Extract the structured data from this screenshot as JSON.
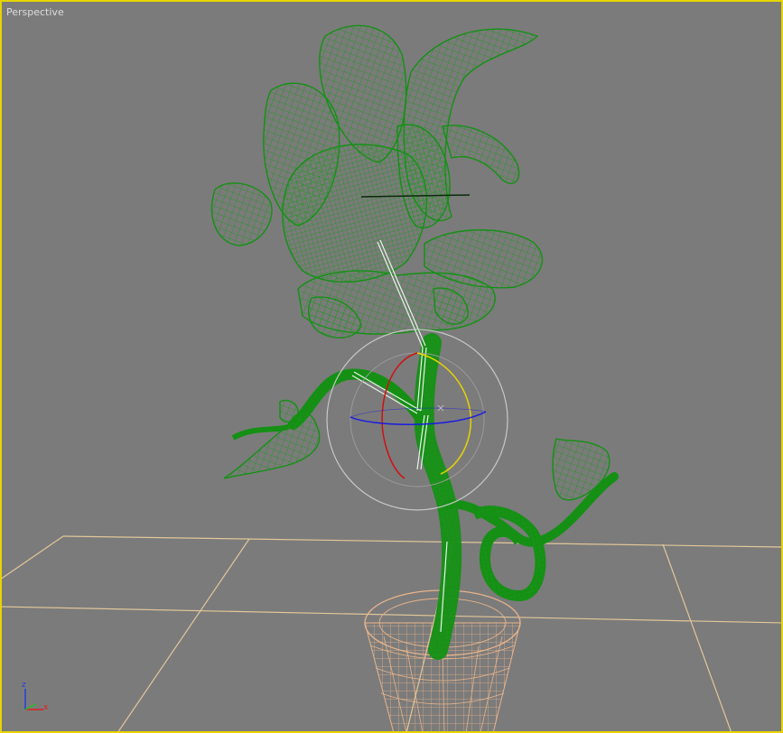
{
  "viewport": {
    "label": "Perspective",
    "border_color": "#e6d400",
    "background": "#7b7b7b"
  },
  "scene": {
    "objects": [
      {
        "name": "flower",
        "type": "wireframe mesh",
        "color": "#1a8c1a"
      },
      {
        "name": "pot",
        "type": "wireframe mesh",
        "color": "#e8b48a"
      },
      {
        "name": "ground-grid",
        "type": "grid",
        "color": "#e2c79a"
      }
    ],
    "gizmo": {
      "type": "rotate",
      "colors": {
        "x": "#d01010",
        "y": "#e6d400",
        "z": "#1a1ae0",
        "outer": "#c8c8c8"
      }
    }
  },
  "axis_tripod": {
    "z_label": "z",
    "x_label": "x",
    "colors": {
      "x": "#e02020",
      "y": "#20c020",
      "z": "#2040e0"
    }
  }
}
